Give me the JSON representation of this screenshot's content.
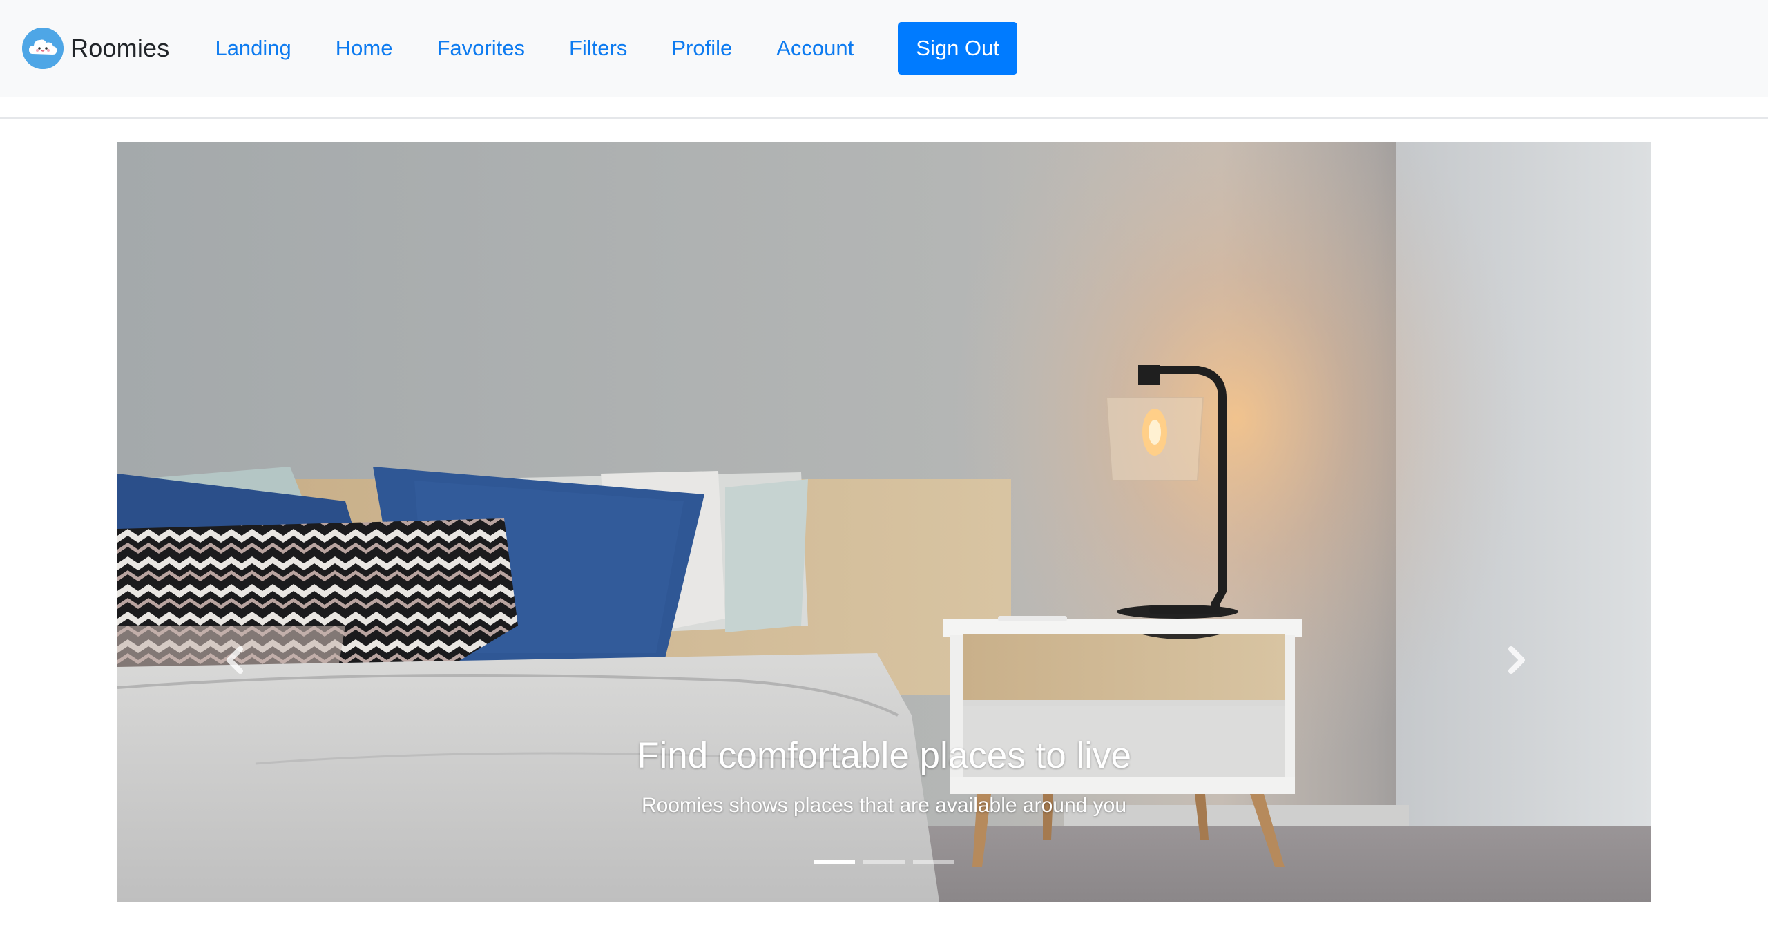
{
  "brand": {
    "name": "Roomies",
    "logo_icon": "cloud-face-icon"
  },
  "nav": {
    "links": [
      {
        "label": "Landing"
      },
      {
        "label": "Home"
      },
      {
        "label": "Favorites"
      },
      {
        "label": "Filters"
      },
      {
        "label": "Profile"
      },
      {
        "label": "Account"
      }
    ],
    "signout_label": "Sign Out"
  },
  "carousel": {
    "slide_image": "bedroom-with-lamp-photo",
    "caption_title": "Find comfortable places to live",
    "caption_text": "Roomies shows places that are available around you",
    "indicator_count": 3,
    "active_indicator": 1,
    "prev_icon": "chevron-left-icon",
    "next_icon": "chevron-right-icon"
  },
  "colors": {
    "navbar_bg": "#f8f9fa",
    "link": "#0d7bf0",
    "primary_button": "#007bff"
  }
}
